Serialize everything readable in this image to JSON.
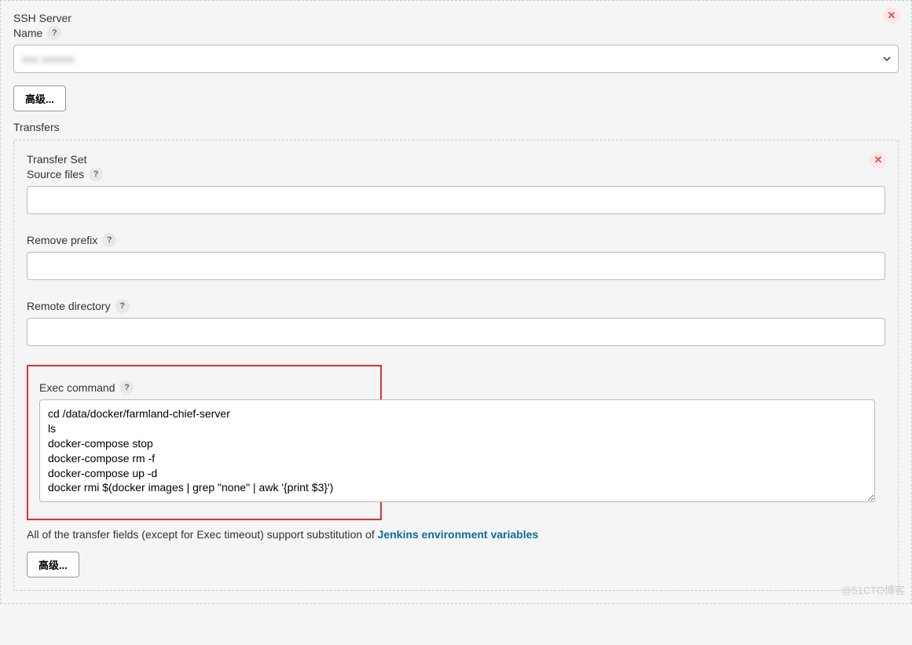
{
  "ssh_server": {
    "label": "SSH Server",
    "name_label": "Name",
    "selected_value": "xxx xxxxxx"
  },
  "advanced_button": "高级...",
  "transfers": {
    "label": "Transfers",
    "transfer_set_label": "Transfer Set",
    "source_files_label": "Source files",
    "source_files_value": "",
    "remove_prefix_label": "Remove prefix",
    "remove_prefix_value": "",
    "remote_directory_label": "Remote directory",
    "remote_directory_value": "",
    "exec_command_label": "Exec command",
    "exec_command_value": "cd /data/docker/farmland-chief-server\nls\ndocker-compose stop\ndocker-compose rm -f\ndocker-compose up -d\ndocker rmi $(docker images | grep \"none\" | awk '{print $3}')",
    "footnote_text": "All of the transfer fields (except for Exec timeout) support substitution of ",
    "footnote_link": "Jenkins environment variables"
  },
  "close_icon": "✕",
  "help_icon": "?",
  "watermark": "@51CTO博客"
}
